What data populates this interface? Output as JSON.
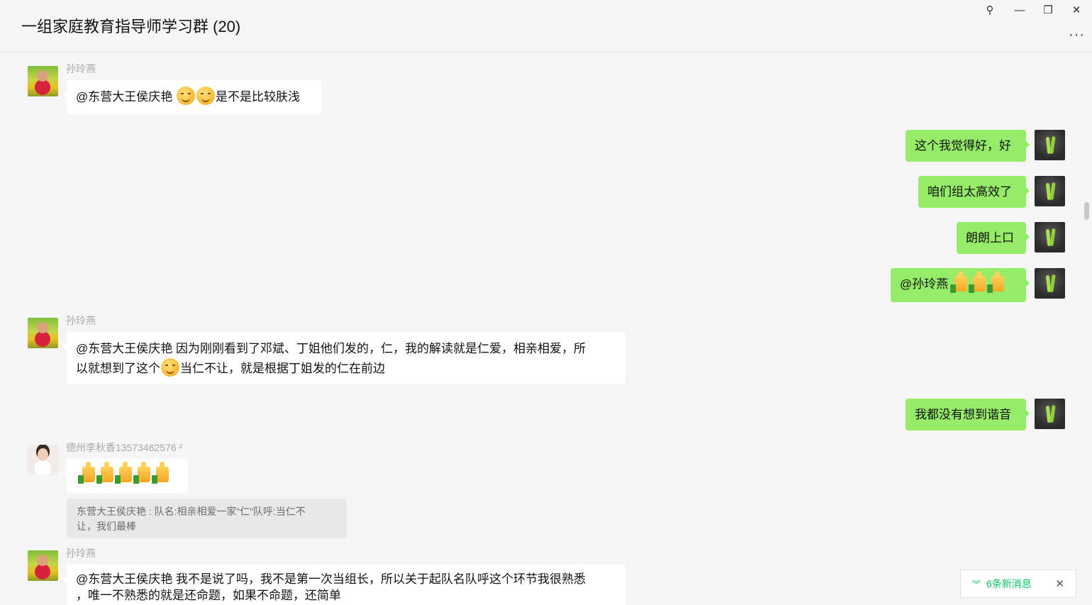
{
  "window": {
    "title": "一组家庭教育指导师学习群 (20)",
    "controls": {
      "pin": "⚲",
      "minimize": "—",
      "restore": "❐",
      "close": "✕"
    },
    "more": "···"
  },
  "messages": [
    {
      "sender": "孙玲燕",
      "text_a": "@东营大王侯庆艳 ",
      "text_b": "是不是比较肤浅"
    },
    {
      "text": "这个我觉得好，好"
    },
    {
      "text": "咱们组太高效了"
    },
    {
      "text": "朗朗上口"
    },
    {
      "text": "@孙玲燕 "
    },
    {
      "sender": "孙玲燕",
      "line1": "@东营大王侯庆艳 因为刚刚看到了邓斌、丁姐他们发的，仁，我的解读就是仁爱，相亲相爱，所",
      "line2a": "以就想到了这个",
      "line2b": "当仁不让，就是根据丁姐发的仁在前边"
    },
    {
      "text": "我都没有想到谐音"
    },
    {
      "sender": "德州李秋香13573462576 ²",
      "quote_line1": "东营大王侯庆艳 : 队名:相亲相爱一家“仁”队呼:当仁不",
      "quote_line2": "让，我们最棒"
    },
    {
      "sender": "孙玲燕",
      "line1": "@东营大王侯庆艳 我不是说了吗，我不是第一次当组长，所以关于起队名队呼这个环节我很熟悉",
      "line2": "，唯一不熟悉的就是还命题，如果不命题，还简单"
    }
  ],
  "new_messages": {
    "chevron": "︾",
    "label": "6条新消息",
    "close": "✕"
  }
}
